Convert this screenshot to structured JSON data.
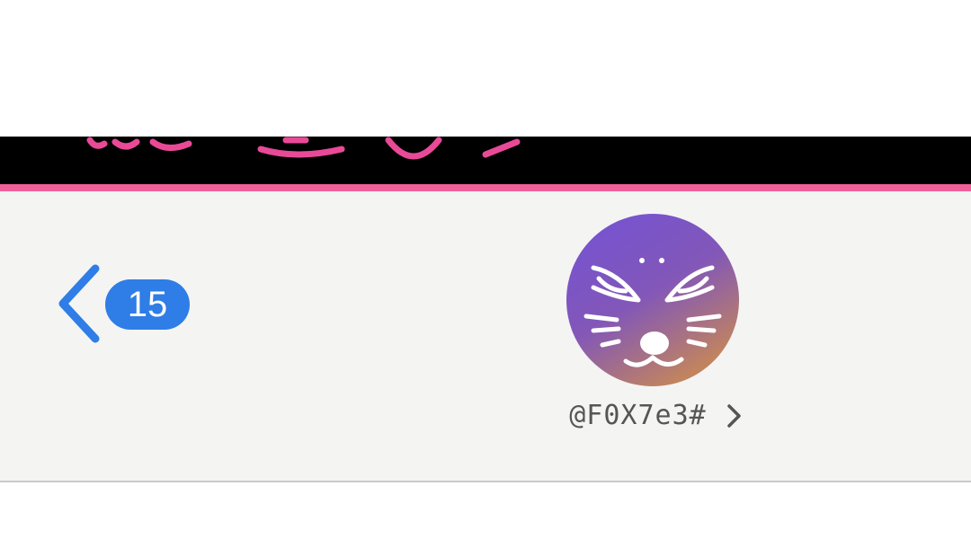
{
  "back": {
    "unread_count": "15",
    "accent_color": "#2f7de6"
  },
  "contact": {
    "handle": "@F0X7e3#",
    "avatar_icon": "cat-face-icon"
  },
  "colors": {
    "top_band": "#000000",
    "pink_accent": "#f0609a",
    "header_background": "#f4f4f3"
  }
}
